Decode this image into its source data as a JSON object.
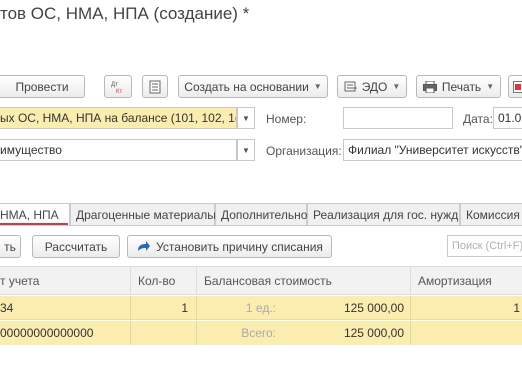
{
  "window": {
    "title": "тов ОС, НМА, НПА (создание) *"
  },
  "toolbar": {
    "post_label": "Провести",
    "dtkt_icon": "Дт Кт",
    "create_based_label": "Создать на основании",
    "edo_label": "ЭДО",
    "print_label": "Печать"
  },
  "header": {
    "operation_value": "ых ОС, НМА, НПА на балансе (101, 102, 1(",
    "number_label": "Номер:",
    "number_value": "",
    "date_label": "Дата:",
    "date_value": "01.0",
    "property_value": "имущество",
    "org_label": "Организация:",
    "org_value": "Филиал \"Университет искусств\""
  },
  "tabs": [
    {
      "label": "НМА, НПА",
      "active": true
    },
    {
      "label": "Драгоценные материалы"
    },
    {
      "label": "Дополнительно"
    },
    {
      "label": "Реализация для гос. нужд"
    },
    {
      "label": "Комиссия"
    }
  ],
  "table_toolbar": {
    "add_label": "ть",
    "calculate_label": "Рассчитать",
    "set_reason_label": "Установить причину списания",
    "search_placeholder": "Поиск (Ctrl+F)"
  },
  "grid": {
    "columns": [
      "т учета",
      "Кол-во",
      "Балансовая стоимость",
      "Амортизация"
    ],
    "rows": [
      {
        "account": "34",
        "qty": "1",
        "unit_label": "1 ед.:",
        "cost": "125 000,00",
        "amort": "1"
      },
      {
        "account": "00000000000000",
        "qty": "",
        "unit_label": "Всего:",
        "cost": "125 000,00",
        "amort": ""
      }
    ]
  },
  "colors": {
    "accent_red": "#d9383a",
    "highlight_yellow": "#fbedb0"
  }
}
